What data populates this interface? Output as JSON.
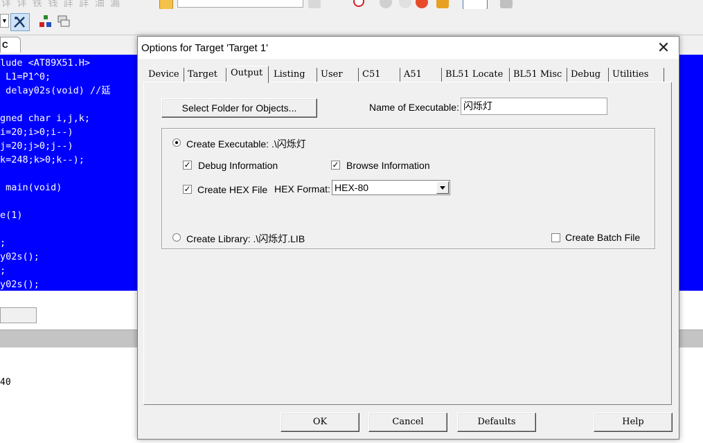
{
  "ide": {
    "toolbar_faded_text": "详 详 铁 钱   詳 詳 油 漏",
    "file_tab": "C",
    "code_lines": [
      "lude <AT89X51.H>",
      " L1=P1^0;",
      " delay02s(void) //延",
      "",
      "gned char i,j,k;",
      "i=20;i>0;i--)",
      "j=20;j>0;j--)",
      "k=248;k>0;k--);",
      "",
      " main(void)",
      "",
      "e(1)",
      "",
      ";",
      "y02s();",
      ";",
      "y02s();"
    ],
    "build_output": "40"
  },
  "dialog": {
    "title": "Options for Target 'Target 1'",
    "close_glyph": "✕",
    "tabs": [
      {
        "label": "Device"
      },
      {
        "label": "Target"
      },
      {
        "label": "Output"
      },
      {
        "label": "Listing"
      },
      {
        "label": "User"
      },
      {
        "label": "C51"
      },
      {
        "label": "A51"
      },
      {
        "label": "BL51 Locate"
      },
      {
        "label": "BL51 Misc"
      },
      {
        "label": "Debug"
      },
      {
        "label": "Utilities"
      }
    ],
    "active_tab": "Output",
    "select_folder_label": "Select Folder for Objects...",
    "name_executable_label": "Name of Executable:",
    "name_executable_value": "闪烁灯",
    "create_executable_label": "Create Executable:  .\\闪烁灯",
    "debug_info_label": "Debug Information",
    "browse_info_label": "Browse Information",
    "create_hex_label": "Create HEX File",
    "hex_format_label": "HEX Format:",
    "hex_format_value": "HEX-80",
    "create_library_label": "Create Library:  .\\闪烁灯.LIB",
    "create_batch_label": "Create Batch File",
    "check_mark": "✓",
    "states": {
      "create_executable": true,
      "create_library": false,
      "debug_info": true,
      "browse_info": true,
      "create_hex": true,
      "create_batch": false
    },
    "buttons": {
      "ok": "OK",
      "cancel": "Cancel",
      "defaults": "Defaults",
      "help": "Help"
    }
  }
}
